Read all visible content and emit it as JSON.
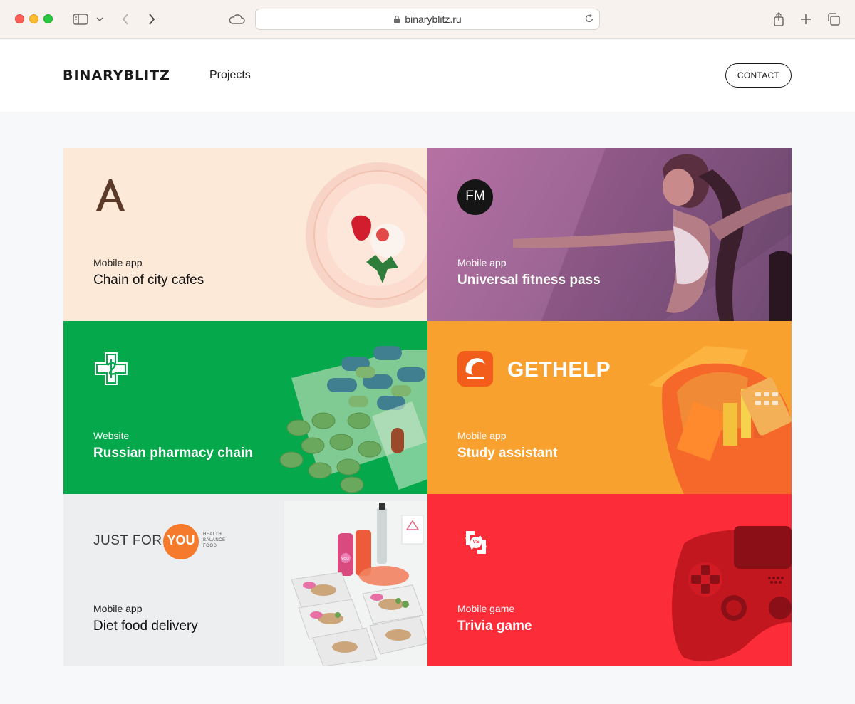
{
  "browser": {
    "url": "binaryblitz.ru"
  },
  "header": {
    "logo": "BINARYBLITZ",
    "nav_projects": "Projects",
    "contact_label": "CONTACT"
  },
  "projects": [
    {
      "kind": "Mobile app",
      "title": "Chain of city cafes",
      "logo_text": "A"
    },
    {
      "kind": "Mobile app",
      "title": "Universal fitness pass",
      "logo_text": "FM"
    },
    {
      "kind": "Website",
      "title": "Russian pharmacy chain"
    },
    {
      "kind": "Mobile app",
      "title": "Study assistant",
      "logo_text": "GETHELP"
    },
    {
      "kind": "Mobile app",
      "title": "Diet food delivery",
      "logo_text_1": "JUST FOR",
      "logo_text_2": "YOU",
      "logo_sub_1": "HEALTH",
      "logo_sub_2": "BALANCE",
      "logo_sub_3": "FOOD",
      "bottle_label": "YOU"
    },
    {
      "kind": "Mobile game",
      "title": "Trivia game",
      "logo_text": "VS"
    }
  ],
  "colors": {
    "cafe_bg": "#fde9d8",
    "fitness_bg": "#8f5a8a",
    "pharmacy_bg": "#05a84b",
    "study_bg": "#f9a12e",
    "diet_bg": "#eceeef",
    "game_bg": "#fc2d39"
  }
}
